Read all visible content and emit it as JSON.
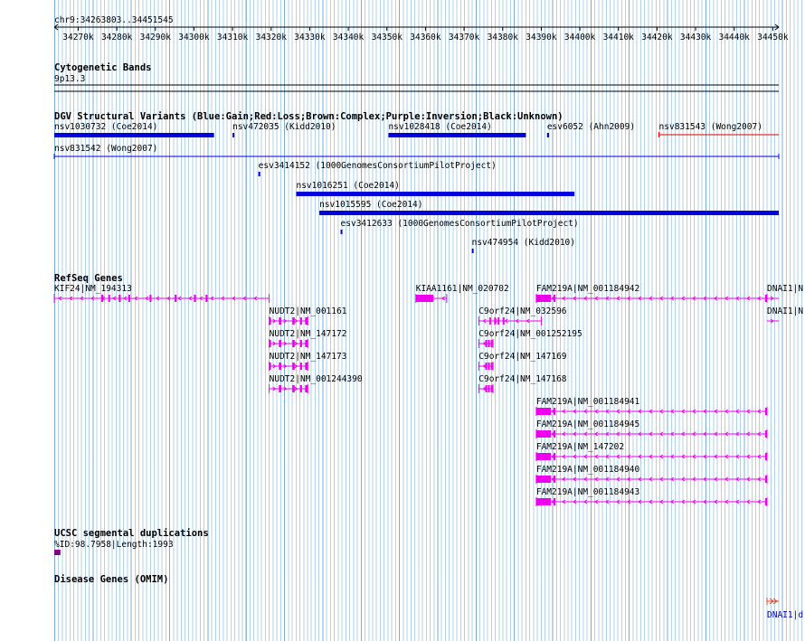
{
  "ruler": {
    "position": "chr9:34263803..34451545",
    "start": 34263803,
    "end": 34451545,
    "ticks": [
      "34270k",
      "34280k",
      "34290k",
      "34300k",
      "34310k",
      "34320k",
      "34330k",
      "34340k",
      "34350k",
      "34360k",
      "34370k",
      "34380k",
      "34390k",
      "34400k",
      "34410k",
      "34420k",
      "34430k",
      "34440k",
      "34450k"
    ]
  },
  "colors": {
    "gain": "#0000dd",
    "loss": "#dd0000",
    "gene": "#ee00ee",
    "segdup": "#800080",
    "omim": "#dd4422"
  },
  "tracks": {
    "cytobands": {
      "title": "Cytogenetic Bands",
      "band": "9p13.3"
    },
    "dgv": {
      "title": "DGV Structural Variants (Blue:Gain;Red:Loss;Brown:Complex;Purple:Inversion;Black:Unknown)",
      "items": [
        {
          "label": "nsv1030732 (Coe2014)",
          "start": 34263803,
          "end": 34305200,
          "type": "gain",
          "row": 0
        },
        {
          "label": "nsv472035 (Kidd2010)",
          "start": 34310000,
          "end": 34310400,
          "type": "gain",
          "row": 0
        },
        {
          "label": "nsv1028418 (Coe2014)",
          "start": 34350400,
          "end": 34386000,
          "type": "gain",
          "row": 0
        },
        {
          "label": "esv6052 (Ahn2009)",
          "start": 34391500,
          "end": 34392000,
          "type": "gain",
          "row": 0
        },
        {
          "label": "nsv831543 (Wong2007)",
          "start": 34420500,
          "end": 34451545,
          "type": "loss",
          "row": 0
        },
        {
          "label": "nsv831542 (Wong2007)",
          "start": 34263803,
          "end": 34451545,
          "type": "gain-thin",
          "row": 1
        },
        {
          "label": "esv3414152 (1000GenomesConsortiumPilotProject)",
          "start": 34316700,
          "end": 34317100,
          "type": "gain",
          "row": 2
        },
        {
          "label": "nsv1016251 (Coe2014)",
          "start": 34326500,
          "end": 34398600,
          "type": "gain",
          "row": 3
        },
        {
          "label": "nsv1015595 (Coe2014)",
          "start": 34332500,
          "end": 34451545,
          "type": "gain",
          "row": 4
        },
        {
          "label": "esv3412633 (1000GenomesConsortiumPilotProject)",
          "start": 34338000,
          "end": 34338400,
          "type": "gain",
          "row": 5
        },
        {
          "label": "nsv474954 (Kidd2010)",
          "start": 34372000,
          "end": 34372400,
          "type": "gain",
          "row": 6
        }
      ]
    },
    "refseq": {
      "title": "RefSeq Genes",
      "genes": [
        {
          "label": "KIF24|NM_194313",
          "row": 0,
          "start": 34263803,
          "end": 34319500,
          "strand": "-",
          "exons": [
            [
              34276000,
              34276500
            ],
            [
              34277800,
              34278200
            ],
            [
              34280500,
              34281000
            ],
            [
              34283000,
              34283400
            ],
            [
              34288500,
              34288800
            ],
            [
              34295000,
              34295400
            ],
            [
              34300000,
              34300500
            ],
            [
              34303000,
              34303500
            ]
          ]
        },
        {
          "label": "KIAA1161|NM_020702",
          "row": 0,
          "start": 34357500,
          "end": 34365500,
          "strand": "-",
          "exons": [
            [
              34357500,
              34362000
            ]
          ]
        },
        {
          "label": "FAM219A|NM_001184942",
          "row": 0,
          "start": 34388700,
          "end": 34448500,
          "strand": "-",
          "exons": [
            [
              34388700,
              34392500
            ],
            [
              34393200,
              34393700
            ],
            [
              34448000,
              34448500
            ]
          ]
        },
        {
          "label": "DNAI1|N",
          "row": 0,
          "start": 34448500,
          "end": 34451545,
          "strand": "+",
          "exons": []
        },
        {
          "label": "NUDT2|NM_001161",
          "row": 1,
          "start": 34319500,
          "end": 34329500,
          "strand": "+",
          "exons": [
            [
              34319500,
              34319800
            ],
            [
              34322000,
              34322600
            ],
            [
              34325500,
              34326100
            ],
            [
              34327500,
              34328000
            ],
            [
              34328800,
              34329500
            ]
          ]
        },
        {
          "label": "C9orf24|NM_032596",
          "row": 1,
          "start": 34373800,
          "end": 34390000,
          "strand": "-",
          "exons": [
            [
              34376500,
              34376800
            ],
            [
              34377800,
              34378100
            ],
            [
              34378700,
              34379000
            ],
            [
              34380000,
              34380400
            ]
          ]
        },
        {
          "label": "DNAI1|N",
          "row": 1,
          "start": 34448500,
          "end": 34451545,
          "strand": "+",
          "exons": []
        },
        {
          "label": "NUDT2|NM_147172",
          "row": 2,
          "start": 34319500,
          "end": 34329500,
          "strand": "+",
          "exons": [
            [
              34319500,
              34319800
            ],
            [
              34322000,
              34322600
            ],
            [
              34325500,
              34326100
            ],
            [
              34327500,
              34328000
            ],
            [
              34328800,
              34329500
            ]
          ]
        },
        {
          "label": "C9orf24|NM_001252195",
          "row": 2,
          "start": 34373800,
          "end": 34377500,
          "strand": "-",
          "exons": [
            [
              34375500,
              34375800
            ],
            [
              34376200,
              34376600
            ],
            [
              34376900,
              34377300
            ]
          ]
        },
        {
          "label": "NUDT2|NM_147173",
          "row": 3,
          "start": 34319500,
          "end": 34329500,
          "strand": "+",
          "exons": [
            [
              34319500,
              34319800
            ],
            [
              34322000,
              34322600
            ],
            [
              34325500,
              34326100
            ],
            [
              34327500,
              34328000
            ],
            [
              34328800,
              34329500
            ]
          ]
        },
        {
          "label": "C9orf24|NM_147169",
          "row": 3,
          "start": 34373800,
          "end": 34377500,
          "strand": "-",
          "exons": [
            [
              34375500,
              34375800
            ],
            [
              34376200,
              34376600
            ],
            [
              34376900,
              34377300
            ]
          ]
        },
        {
          "label": "NUDT2|NM_001244390",
          "row": 4,
          "start": 34319500,
          "end": 34329500,
          "strand": "+",
          "exons": [
            [
              34322000,
              34322600
            ],
            [
              34325500,
              34326100
            ],
            [
              34327500,
              34328000
            ],
            [
              34328800,
              34329500
            ]
          ]
        },
        {
          "label": "C9orf24|NM_147168",
          "row": 4,
          "start": 34373800,
          "end": 34377500,
          "strand": "-",
          "exons": [
            [
              34375500,
              34375800
            ],
            [
              34376200,
              34376600
            ],
            [
              34376900,
              34377300
            ]
          ]
        },
        {
          "label": "FAM219A|NM_001184941",
          "row": 5,
          "start": 34388700,
          "end": 34448500,
          "strand": "-",
          "exons": [
            [
              34388700,
              34392500
            ],
            [
              34393200,
              34393700
            ],
            [
              34448000,
              34448500
            ]
          ]
        },
        {
          "label": "FAM219A|NM_001184945",
          "row": 6,
          "start": 34388700,
          "end": 34448500,
          "strand": "-",
          "exons": [
            [
              34388700,
              34392500
            ],
            [
              34393200,
              34393700
            ],
            [
              34448000,
              34448500
            ]
          ]
        },
        {
          "label": "FAM219A|NM_147202",
          "row": 7,
          "start": 34388700,
          "end": 34448500,
          "strand": "-",
          "exons": [
            [
              34388700,
              34392500
            ],
            [
              34393200,
              34393700
            ],
            [
              34448000,
              34448500
            ]
          ]
        },
        {
          "label": "FAM219A|NM_001184940",
          "row": 8,
          "start": 34388700,
          "end": 34448500,
          "strand": "-",
          "exons": [
            [
              34388700,
              34392500
            ],
            [
              34393200,
              34393700
            ],
            [
              34448000,
              34448500
            ]
          ]
        },
        {
          "label": "FAM219A|NM_001184943",
          "row": 9,
          "start": 34388700,
          "end": 34448500,
          "strand": "-",
          "exons": [
            [
              34388700,
              34392500
            ],
            [
              34393200,
              34393700
            ],
            [
              34448000,
              34448500
            ]
          ]
        }
      ]
    },
    "segdup": {
      "title": "UCSC segmental duplications",
      "label": "%ID:98.7958|Length:1993",
      "start": 34263803,
      "end": 34265400
    },
    "omim": {
      "title": "Disease Genes (OMIM)",
      "label": "DNAI1|d",
      "start": 34448500,
      "end": 34451545
    }
  }
}
